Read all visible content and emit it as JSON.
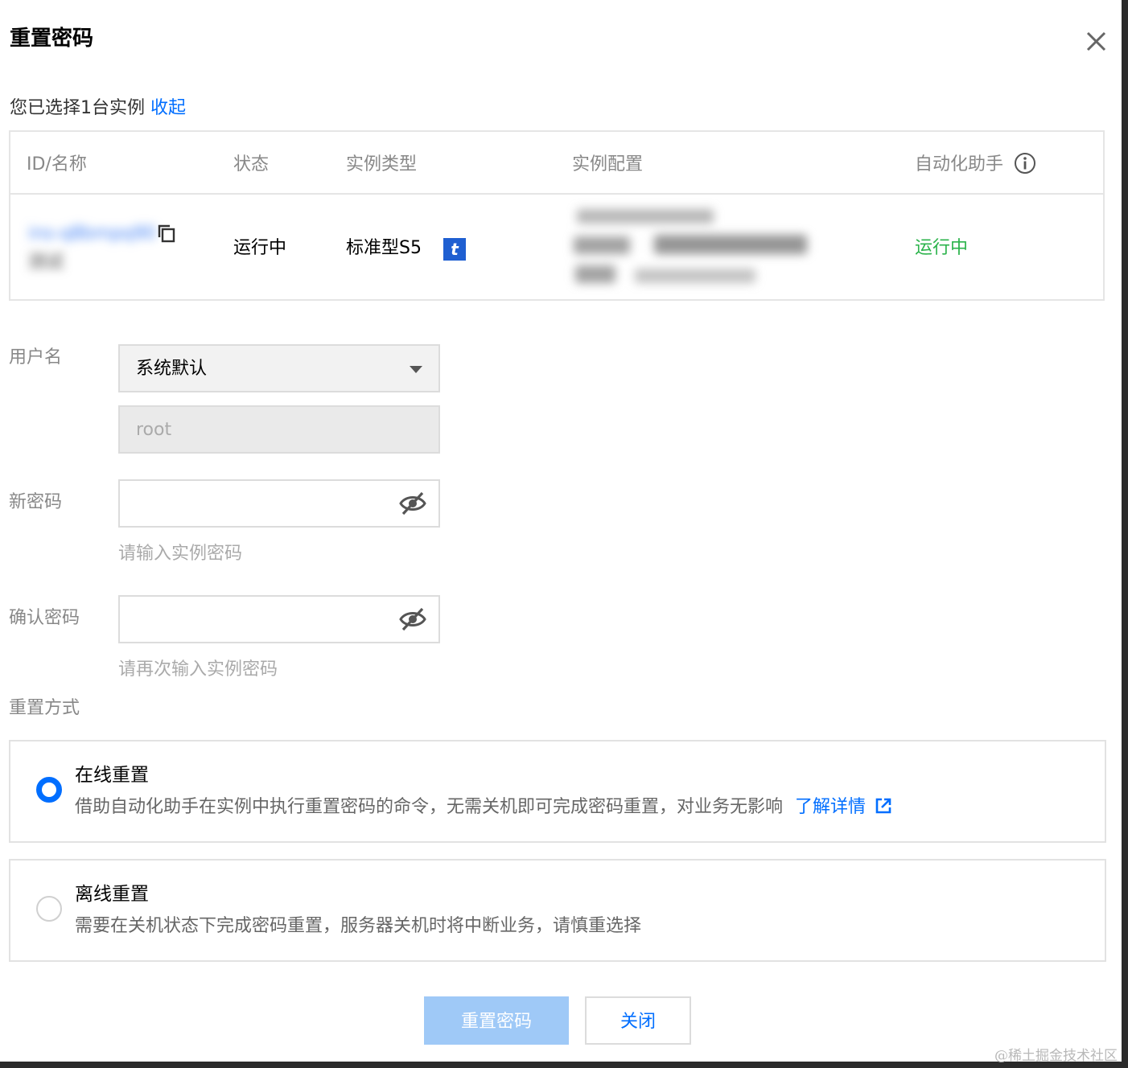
{
  "dialog": {
    "title": "重置密码",
    "selected_prefix": "您已选择1台实例",
    "collapse_link": "收起"
  },
  "table": {
    "headers": {
      "id_name": "ID/名称",
      "status": "状态",
      "instance_type": "实例类型",
      "instance_config": "实例配置",
      "automation_assistant": "自动化助手"
    },
    "rows": [
      {
        "instance_id": "ins-q8bmpq90",
        "instance_name": "测试",
        "status": "运行中",
        "instance_type": "标准型S5",
        "type_badge": "t",
        "automation_status": "运行中"
      }
    ]
  },
  "form": {
    "username_label": "用户名",
    "username_select": "系统默认",
    "username_value": "root",
    "new_password_label": "新密码",
    "new_password_hint": "请输入实例密码",
    "confirm_password_label": "确认密码",
    "confirm_password_hint": "请再次输入实例密码",
    "reset_method_label": "重置方式"
  },
  "options": [
    {
      "title": "在线重置",
      "desc": "借助自动化助手在实例中执行重置密码的命令，无需关机即可完成密码重置，对业务无影响",
      "link": "了解详情",
      "selected": true
    },
    {
      "title": "离线重置",
      "desc": "需要在关机状态下完成密码重置，服务器关机时将中断业务，请慎重选择",
      "selected": false
    }
  ],
  "buttons": {
    "reset": "重置密码",
    "close": "关闭"
  },
  "watermark": "@稀土掘金技术社区",
  "colors": {
    "accent": "#006eff",
    "running": "#2bb34b",
    "primary_disabled": "#9fc9f7",
    "badge": "#1f5fd1"
  },
  "icons": {
    "close": "close-icon",
    "copy": "copy-icon",
    "info": "info-icon",
    "eye_off": "eye-off-icon",
    "external_link": "external-link-icon",
    "caret": "caret-down-icon"
  }
}
